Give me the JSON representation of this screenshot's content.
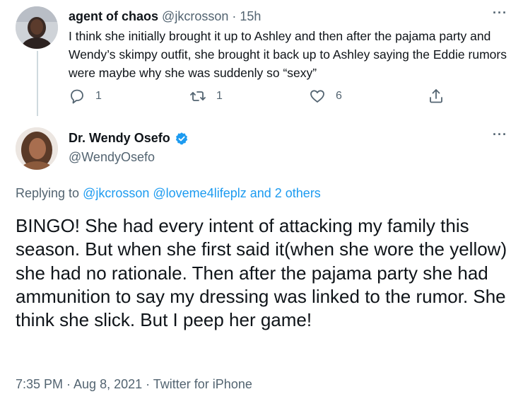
{
  "reply": {
    "display_name": "agent of chaos",
    "handle": "@jkcrosson",
    "separator": " · ",
    "time": "15h",
    "more": "···",
    "text": "I think she initially brought it up to Ashley and then after the pajama party and Wendy’s skimpy outfit, she brought it back up to Ashley saying the Eddie rumors were maybe why she was suddenly so “sexy”",
    "actions": {
      "reply_count": "1",
      "retweet_count": "1",
      "like_count": "6"
    }
  },
  "tweet": {
    "display_name": "Dr. Wendy Osefo",
    "handle": "@WendyOsefo",
    "more": "···",
    "replying_prefix": "Replying to ",
    "replying_user1": "@jkcrosson",
    "replying_user2": "@loveme4lifeplz",
    "replying_others": "and 2 others",
    "text": "BINGO! She had every intent of attacking my family this season. But when she first said it(when she wore the yellow) she had no rationale. Then after the pajama party she had ammunition to say my dressing was linked to the rumor. She think she slick. But I peep her game!",
    "timestamp": "7:35 PM · Aug 8, 2021 · Twitter for iPhone"
  },
  "colors": {
    "link": "#1d9bf0",
    "muted": "#536471",
    "text": "#0f1419",
    "thread_line": "#cfd9de"
  }
}
